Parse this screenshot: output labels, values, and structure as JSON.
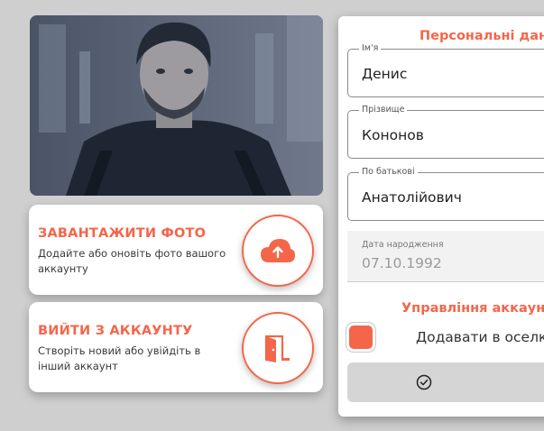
{
  "upload_card": {
    "title": "ЗАВАНТАЖИТИ ФОТО",
    "description": "Додайте або оновіть фото вашого аккаунту",
    "icon": "cloud-upload-icon"
  },
  "logout_card": {
    "title": "ВИЙТИ З АККАУНТУ",
    "description": "Створіть новий або увійдіть в інший аккаунт",
    "icon": "door-exit-icon"
  },
  "personal": {
    "title": "Персональні дан",
    "first_name": {
      "label": "Ім'я",
      "value": "Денис"
    },
    "last_name": {
      "label": "Прізвище",
      "value": "Кононов"
    },
    "patronymic": {
      "label": "По батькові",
      "value": "Анатолійович"
    },
    "birth_date": {
      "label": "Дата народження",
      "value": "07.10.1992"
    }
  },
  "account": {
    "title": "Управління аккаунт",
    "toggle_label": "Додавати в оселк",
    "toggle_checked": true,
    "confirm_icon": "check-circle-icon"
  },
  "colors": {
    "accent": "#f4664a",
    "background": "#cfcfcf",
    "card": "#ffffff"
  }
}
